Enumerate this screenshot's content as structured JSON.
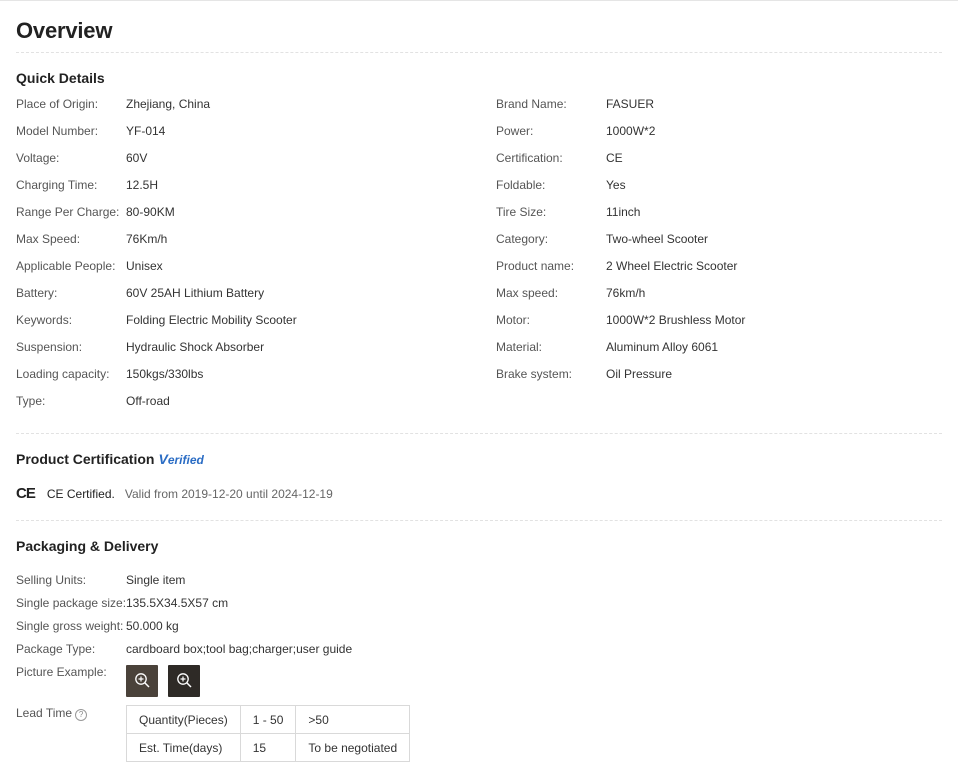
{
  "overview_title": "Overview",
  "quick_details": {
    "title": "Quick Details",
    "left": [
      {
        "k": "Place of Origin:",
        "v": "Zhejiang, China"
      },
      {
        "k": "Model Number:",
        "v": "YF-014"
      },
      {
        "k": "Voltage:",
        "v": "60V"
      },
      {
        "k": "Charging Time:",
        "v": "12.5H"
      },
      {
        "k": "Range Per Charge:",
        "v": "80-90KM"
      },
      {
        "k": "Max Speed:",
        "v": "76Km/h"
      },
      {
        "k": "Applicable People:",
        "v": "Unisex"
      },
      {
        "k": "Battery:",
        "v": "60V 25AH Lithium Battery"
      },
      {
        "k": "Keywords:",
        "v": "Folding Electric Mobility Scooter"
      },
      {
        "k": "Suspension:",
        "v": "Hydraulic Shock Absorber"
      },
      {
        "k": "Loading capacity:",
        "v": "150kgs/330lbs"
      },
      {
        "k": "Type:",
        "v": "Off-road"
      }
    ],
    "right": [
      {
        "k": "Brand Name:",
        "v": "FASUER"
      },
      {
        "k": "Power:",
        "v": "1000W*2"
      },
      {
        "k": "Certification:",
        "v": "CE"
      },
      {
        "k": "Foldable:",
        "v": "Yes"
      },
      {
        "k": "Tire Size:",
        "v": "11inch"
      },
      {
        "k": "Category:",
        "v": "Two-wheel Scooter"
      },
      {
        "k": "Product name:",
        "v": "2 Wheel Electric Scooter"
      },
      {
        "k": "Max speed:",
        "v": "76km/h"
      },
      {
        "k": "Motor:",
        "v": "1000W*2 Brushless Motor"
      },
      {
        "k": "Material:",
        "v": "Aluminum Alloy 6061"
      },
      {
        "k": "Brake system:",
        "v": "Oil Pressure"
      }
    ]
  },
  "certification": {
    "title": "Product Certification",
    "verified_v": "V",
    "verified_rest": "erified",
    "mark": "CE",
    "name": "CE Certified.",
    "valid": "Valid from 2019-12-20 until 2024-12-19"
  },
  "packaging": {
    "title": "Packaging & Delivery",
    "rows": [
      {
        "k": "Selling Units:",
        "v": "Single item"
      },
      {
        "k": "Single package size:",
        "v": "135.5X34.5X57 cm"
      },
      {
        "k": "Single gross weight:",
        "v": "50.000 kg"
      },
      {
        "k": "Package Type:",
        "v": "cardboard box;tool bag;charger;user guide"
      }
    ],
    "picture_label": "Picture Example:",
    "lead_label": "Lead Time",
    "help_glyph": "?",
    "lead_table": {
      "row1": [
        "Quantity(Pieces)",
        "1 - 50",
        ">50"
      ],
      "row2": [
        "Est. Time(days)",
        "15",
        "To be negotiated"
      ]
    }
  }
}
